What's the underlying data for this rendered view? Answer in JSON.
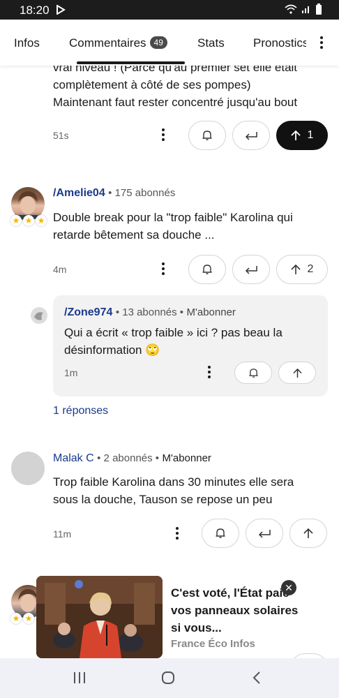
{
  "status_bar": {
    "time": "18:20"
  },
  "tabs": {
    "infos": "Infos",
    "comments": "Commentaires",
    "comments_count": "49",
    "stats": "Stats",
    "prono": "Pronostics"
  },
  "comment1": {
    "text_line1": "vrai niveau ! (Parce qu'au premier set elle était",
    "text_line2": "complètement à côté de ses pompes)",
    "text_line3": "Maintenant faut rester concentré jusqu'au bout",
    "time": "51s",
    "votes": "1"
  },
  "comment2": {
    "author": "/Amelie04",
    "subscribers": "• 175 abonnés",
    "text_line1": "Double break pour la \"trop faible\" Karolina qui",
    "text_line2": "retarde bêtement sa douche ...",
    "time": "4m",
    "votes": "2"
  },
  "reply": {
    "author": "/Zone974",
    "subscribers": "• 13 abonnés •",
    "follow": "M'abonner",
    "text_line1": "Qui a écrit « trop faible » ici ? pas beau la",
    "text_line2": "désinformation",
    "emoji": "🙄",
    "time": "1m"
  },
  "replies_link": "1 réponses",
  "comment3": {
    "author": "Malak C",
    "subscribers": "• 2 abonnés •",
    "follow": "M'abonner",
    "text_line1": "Trop faible Karolina dans 30 minutes elle sera",
    "text_line2": "sous la douche, Tauson se repose un peu",
    "time": "11m"
  },
  "ad": {
    "title": "C'est voté, l'État paie vos panneaux solaires si vous...",
    "source": "France Éco Infos"
  },
  "colors": {
    "author_blue": "#1a3a8a",
    "star_gold": "#f2b701",
    "upvote_active": "#111111"
  }
}
